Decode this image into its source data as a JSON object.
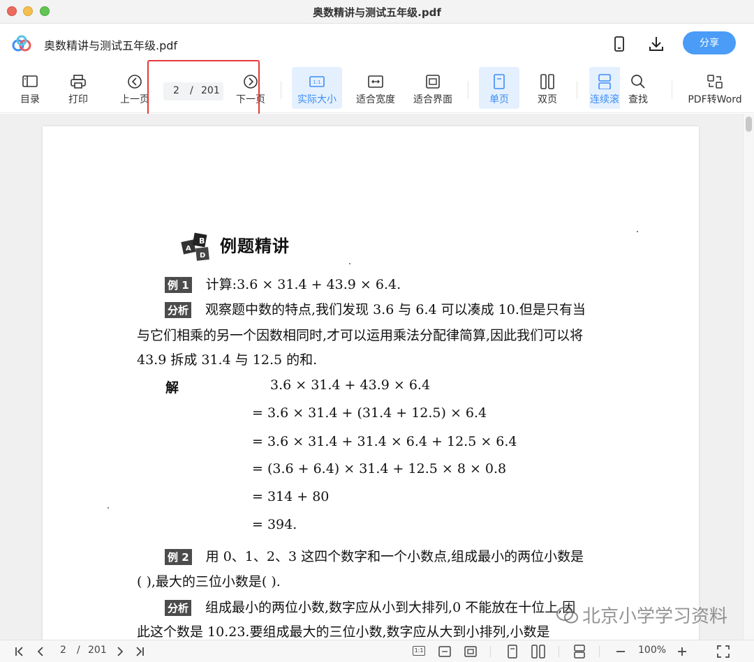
{
  "window": {
    "title": "奥数精讲与测试五年级.pdf"
  },
  "header": {
    "filename": "奥数精讲与测试五年级.pdf",
    "share_label": "分享"
  },
  "toolbar": {
    "toc": "目录",
    "print": "打印",
    "prev_page": "上一页",
    "next_page": "下一页",
    "current_page": "2",
    "slash": "/",
    "total_pages": "201",
    "actual_size": "实际大小",
    "fit_width": "适合宽度",
    "fit_page": "适合界面",
    "single_page": "单页",
    "double_page": "双页",
    "continuous": "连续滚",
    "find": "查找",
    "pdf_to_word": "PDF转Word"
  },
  "document": {
    "heading": "例题精讲",
    "ex1_tag": "例 1",
    "ex1_text": "计算:3.6 × 31.4 + 43.9 × 6.4.",
    "an1_tag": "分析",
    "an1_line1": "观察题中数的特点,我们发现 3.6 与 6.4 可以凑成 10.但是只有当",
    "an1_line2": "与它们相乘的另一个因数相同时,才可以运用乘法分配律简算,因此我们可以将",
    "an1_line3": "43.9 拆成 31.4 与 12.5 的和.",
    "sol_label": "解",
    "sol_1": "3.6 × 31.4 + 43.9 × 6.4",
    "sol_2": "= 3.6 × 31.4 + (31.4 + 12.5) × 6.4",
    "sol_3": "= 3.6 × 31.4 + 31.4 × 6.4 + 12.5 × 6.4",
    "sol_4": "= (3.6 + 6.4) × 31.4 + 12.5 × 8 × 0.8",
    "sol_5": "= 314 + 80",
    "sol_6": "= 394.",
    "ex2_tag": "例 2",
    "ex2_line1": "用 0、1、2、3 这四个数字和一个小数点,组成最小的两位小数是",
    "ex2_line2": "(      ),最大的三位小数是(      ).",
    "an2_tag": "分析",
    "an2_line1": "组成最小的两位小数,数字应从小到大排列,0 不能放在十位上,因",
    "an2_line2": "此这个数是 10.23.要组成最大的三位小数,数字应从大到小排列,小数是"
  },
  "watermark": {
    "text": "北京小学学习资料"
  },
  "statusbar": {
    "current_page": "2",
    "slash": "/",
    "total_pages": "201",
    "zoom": "100%",
    "one_to_one": "1:1"
  },
  "colors": {
    "accent": "#4a9cf7",
    "active_bg": "#e5f0fe",
    "highlight_box": "#e5393a"
  },
  "icons": [
    "app-logo-icon",
    "phone-icon",
    "download-icon",
    "toc-icon",
    "print-icon",
    "prev-page-icon",
    "next-page-icon",
    "actual-size-icon",
    "fit-width-icon",
    "fit-page-icon",
    "single-page-icon",
    "double-page-icon",
    "continuous-icon",
    "search-icon",
    "pdf-to-word-icon",
    "first-page-icon",
    "last-page-icon",
    "fullscreen-icon",
    "wechat-icon"
  ]
}
